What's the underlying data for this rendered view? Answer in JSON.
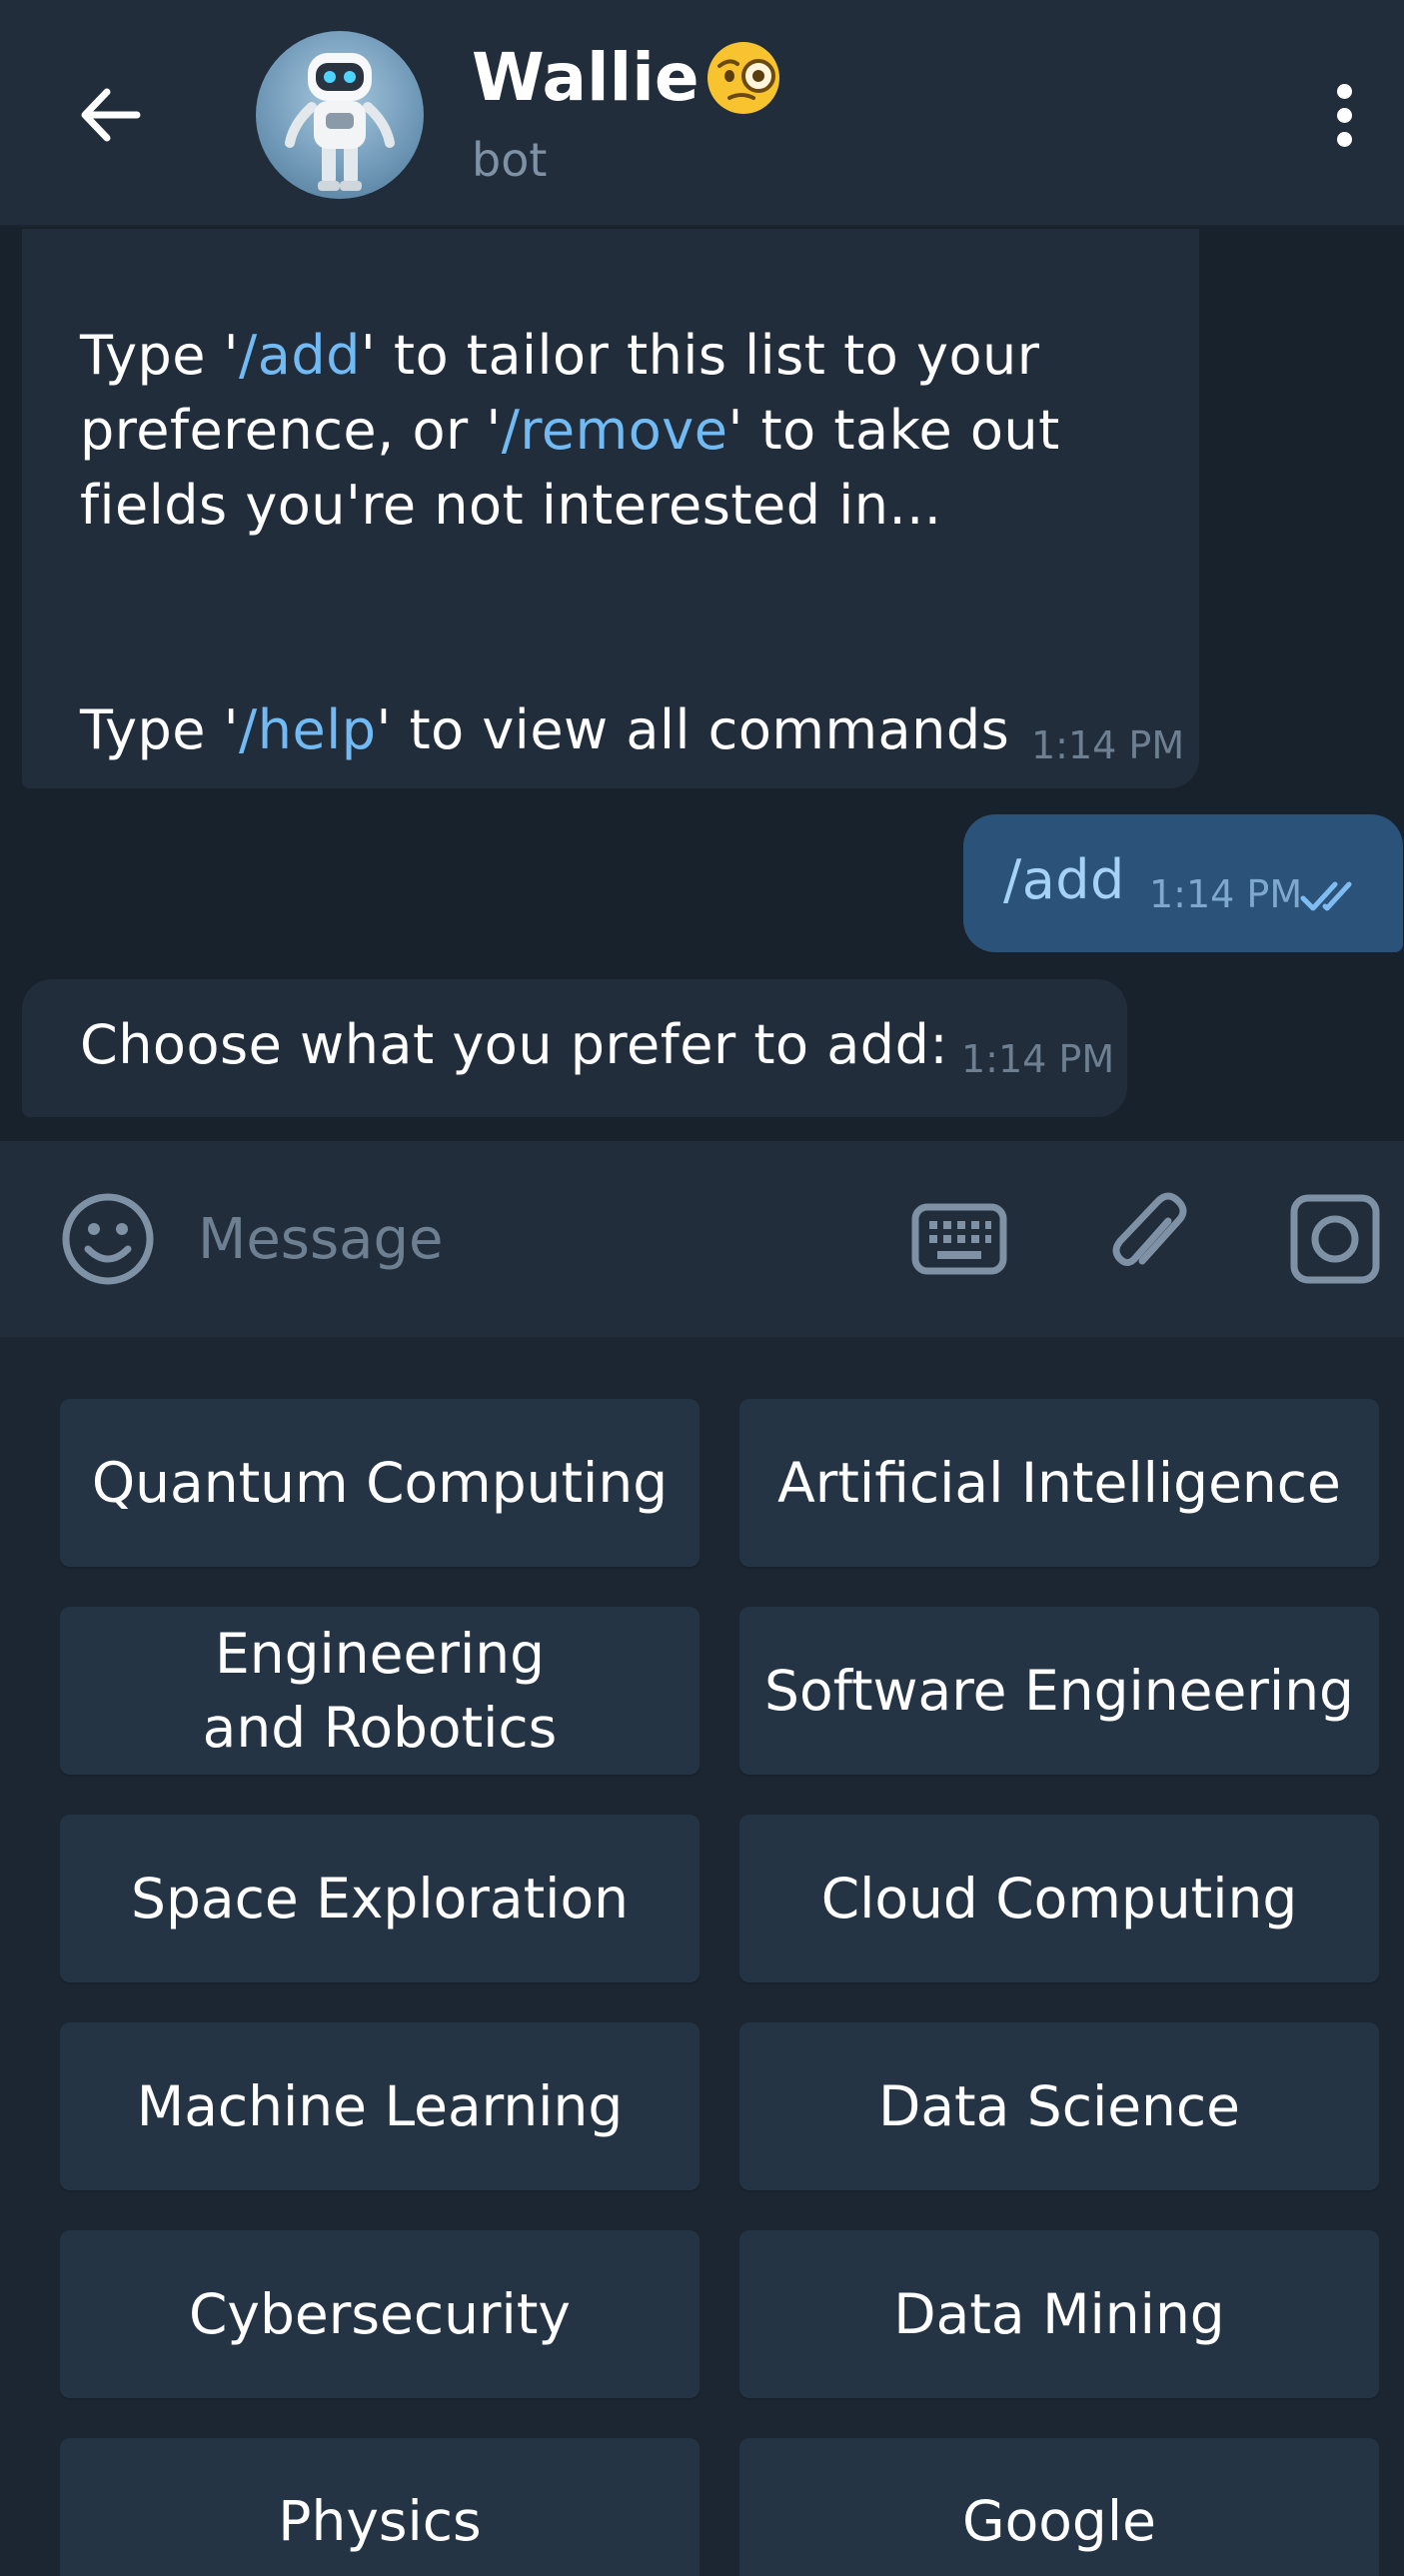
{
  "header": {
    "title": "Wallie",
    "subtitle": "bot"
  },
  "chat": {
    "message1": {
      "line1_pre": "Type '",
      "line1_cmd": "/add",
      "line1_post": "' to tailor this list to your",
      "line2_pre": "preference, or '",
      "line2_cmd": "/remove",
      "line2_post": "' to take out",
      "line3": "fields you're not interested in...",
      "line4_pre": "Type '",
      "line4_cmd": "/help",
      "line4_post": "' to view all commands",
      "time": "1:14 PM"
    },
    "message2": {
      "text": "/add",
      "time": "1:14 PM"
    },
    "message3": {
      "text": "Choose what you prefer to add:",
      "time": "1:14 PM"
    }
  },
  "input": {
    "placeholder": "Message"
  },
  "keyboard": {
    "buttons": [
      "Quantum Computing",
      "Artificial Intelligence",
      "Engineering and Robotics",
      "Software Engineering",
      "Space Exploration",
      "Cloud Computing",
      "Machine Learning",
      "Data Science",
      "Cybersecurity",
      "Data Mining",
      "Physics",
      "Google"
    ]
  },
  "colors": {
    "header_bg": "#212d3b",
    "chat_bg": "#18222d",
    "incoming_bubble": "#212d3b",
    "outgoing_bubble": "#2b5278",
    "command_link": "#71baf4",
    "keyboard_button": "#253444"
  }
}
